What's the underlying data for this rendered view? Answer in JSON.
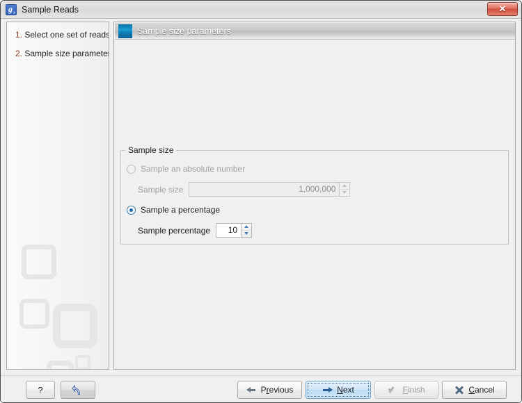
{
  "window": {
    "title": "Sample Reads",
    "app_icon": "application-icon",
    "close_label": "✕"
  },
  "sidebar": {
    "steps": [
      {
        "num": "1.",
        "label": "Select one set of reads"
      },
      {
        "num": "2.",
        "label": "Sample size parameters"
      }
    ]
  },
  "panel": {
    "header_title": "Sample size parameters",
    "group": {
      "legend": "Sample size",
      "options": [
        {
          "id": "absolute",
          "label": "Sample an absolute number",
          "selected": false,
          "field_label": "Sample size",
          "field_value": "1,000,000",
          "disabled": true
        },
        {
          "id": "percentage",
          "label": "Sample a percentage",
          "selected": true,
          "field_label": "Sample percentage",
          "field_value": "10",
          "disabled": false
        }
      ]
    }
  },
  "buttons": {
    "help": "?",
    "reset": "reset-icon",
    "previous": {
      "pre": "P",
      "mn": "r",
      "post": "evious"
    },
    "next": {
      "pre": "",
      "mn": "N",
      "post": "ext"
    },
    "finish": {
      "pre": "",
      "mn": "F",
      "post": "inish",
      "disabled": true
    },
    "cancel": {
      "pre": "",
      "mn": "C",
      "post": "ancel"
    }
  },
  "colors": {
    "accent_blue": "#1a72b8",
    "header_icon": "#0c81b8",
    "close_red": "#d14f3d",
    "step_number": "#8f3a18",
    "panel_bg": "#f0f0f0"
  }
}
